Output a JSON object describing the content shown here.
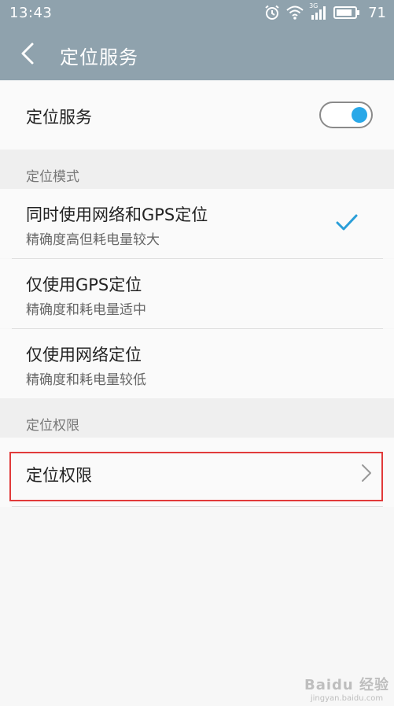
{
  "status_bar": {
    "time": "13:43",
    "network": "3G",
    "battery": "71"
  },
  "header": {
    "title": "定位服务"
  },
  "location_service": {
    "label": "定位服务",
    "enabled": true
  },
  "mode_section": {
    "label": "定位模式",
    "options": [
      {
        "title": "同时使用网络和GPS定位",
        "subtitle": "精确度高但耗电量较大",
        "selected": true
      },
      {
        "title": "仅使用GPS定位",
        "subtitle": "精确度和耗电量适中",
        "selected": false
      },
      {
        "title": "仅使用网络定位",
        "subtitle": "精确度和耗电量较低",
        "selected": false
      }
    ]
  },
  "permission_section": {
    "label": "定位权限",
    "item_label": "定位权限"
  },
  "watermark": {
    "text": "Baidu 经验",
    "sub": "jingyan.baidu.com"
  },
  "colors": {
    "header_bg": "#8fa2ad",
    "accent": "#29a8e8",
    "highlight": "#e13a3a"
  }
}
